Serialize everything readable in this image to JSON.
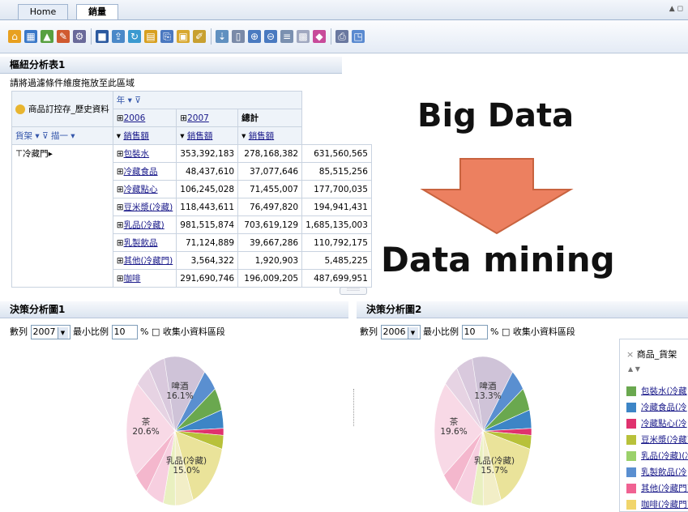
{
  "tabs": [
    {
      "label": "Home"
    },
    {
      "label": "銷量"
    }
  ],
  "toolbar_icons": [
    "home-icon",
    "grid-icon",
    "chart-icon",
    "filter-icon",
    "settings-icon",
    "save-icon",
    "export-icon",
    "refresh-icon",
    "table-icon",
    "copy-icon",
    "folder-icon",
    "edit-icon",
    "drill-icon",
    "page-icon",
    "zoom-in-icon",
    "zoom-out-icon",
    "list-icon",
    "layout-icon",
    "color-icon",
    "print-icon",
    "window-icon"
  ],
  "pivot": {
    "title": "樞紐分析表1",
    "hint": "請將過濾條件維度拖放至此區域",
    "measure_label": "商品訂控存_歷史資料",
    "year_label": "年",
    "col_2006": "2006",
    "col_2007": "2007",
    "col_total": "總計",
    "row_dim1": "貨架",
    "row_dim2": "描一",
    "sales_label": "銷售額",
    "group_label": "冷藏門",
    "rows": [
      {
        "name": "包裝水",
        "v2006": "353,392,183",
        "v2007": "278,168,382",
        "total": "631,560,565"
      },
      {
        "name": "冷藏食品",
        "v2006": "48,437,610",
        "v2007": "37,077,646",
        "total": "85,515,256"
      },
      {
        "name": "冷藏點心",
        "v2006": "106,245,028",
        "v2007": "71,455,007",
        "total": "177,700,035"
      },
      {
        "name": "豆米漿(冷藏)",
        "v2006": "118,443,611",
        "v2007": "76,497,820",
        "total": "194,941,431"
      },
      {
        "name": "乳品(冷藏)",
        "v2006": "981,515,874",
        "v2007": "703,619,129",
        "total": "1,685,135,003"
      },
      {
        "name": "乳製飲品",
        "v2006": "71,124,889",
        "v2007": "39,667,286",
        "total": "110,792,175"
      },
      {
        "name": "其他(冷藏門)",
        "v2006": "3,564,322",
        "v2007": "1,920,903",
        "total": "5,485,225"
      },
      {
        "name": "咖啡",
        "v2006": "291,690,746",
        "v2007": "196,009,205",
        "total": "487,699,951"
      }
    ]
  },
  "overlay": {
    "big_data": "Big Data",
    "data_mining": "Data mining",
    "arrow_color": "#ec8060"
  },
  "chart1": {
    "title": "決策分析圖1",
    "series_label": "數列",
    "series_value": "2007",
    "min_ratio_label": "最小比例",
    "min_ratio_value": "10",
    "collect_label": "% □ 收集小資料區段",
    "labels": [
      {
        "name": "啤酒",
        "pct": "16.1%"
      },
      {
        "name": "茶",
        "pct": "20.6%"
      },
      {
        "name": "乳品(冷藏)",
        "pct": "15.0%"
      }
    ]
  },
  "chart2": {
    "title": "決策分析圖2",
    "series_label": "數列",
    "series_value": "2006",
    "min_ratio_label": "最小比例",
    "min_ratio_value": "10",
    "collect_label": "% □ 收集小資料區段",
    "labels": [
      {
        "name": "啤酒",
        "pct": "13.3%"
      },
      {
        "name": "茶",
        "pct": "19.6%"
      },
      {
        "name": "乳品(冷藏)",
        "pct": "15.7%"
      }
    ]
  },
  "legend": {
    "title": "商品_貨架",
    "items": [
      {
        "label": "包裝水(冷藏",
        "color": "#6aa84f"
      },
      {
        "label": "冷藏食品(冷",
        "color": "#3d85c6"
      },
      {
        "label": "冷藏點心(冷",
        "color": "#e0326e"
      },
      {
        "label": "豆米漿(冷藏)",
        "color": "#b8c13a"
      },
      {
        "label": "乳品(冷藏)(冷",
        "color": "#9bd16a"
      },
      {
        "label": "乳製飲品(冷",
        "color": "#5a8fd0"
      },
      {
        "label": "其他(冷藏門)",
        "color": "#f06292"
      },
      {
        "label": "咖啡(冷藏門)",
        "color": "#f1d56b"
      }
    ]
  }
}
